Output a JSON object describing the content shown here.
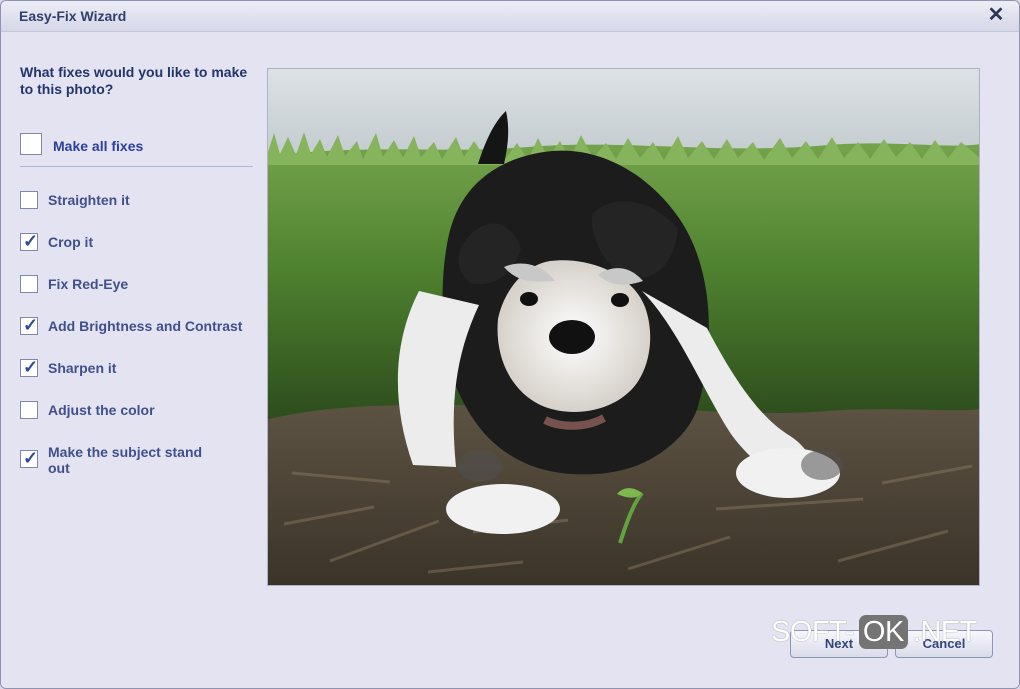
{
  "window": {
    "title": "Easy-Fix Wizard"
  },
  "question": "What fixes would you like to make to this photo?",
  "make_all": {
    "label": "Make all fixes",
    "checked": false
  },
  "fixes": [
    {
      "label": "Straighten it",
      "checked": false
    },
    {
      "label": "Crop it",
      "checked": true
    },
    {
      "label": "Fix Red-Eye",
      "checked": false
    },
    {
      "label": "Add Brightness and Contrast",
      "checked": true
    },
    {
      "label": "Sharpen it",
      "checked": true
    },
    {
      "label": "Adjust the color",
      "checked": false
    },
    {
      "label": "Make the subject stand out",
      "checked": true
    }
  ],
  "buttons": {
    "next": "Next",
    "cancel": "Cancel"
  },
  "watermark": {
    "left": "SOFT-",
    "middle": "OK",
    "right": ".NET"
  },
  "colors": {
    "background": "#e3e3f1",
    "title": "#2f3f6e",
    "accent": "#2b3f9c"
  }
}
